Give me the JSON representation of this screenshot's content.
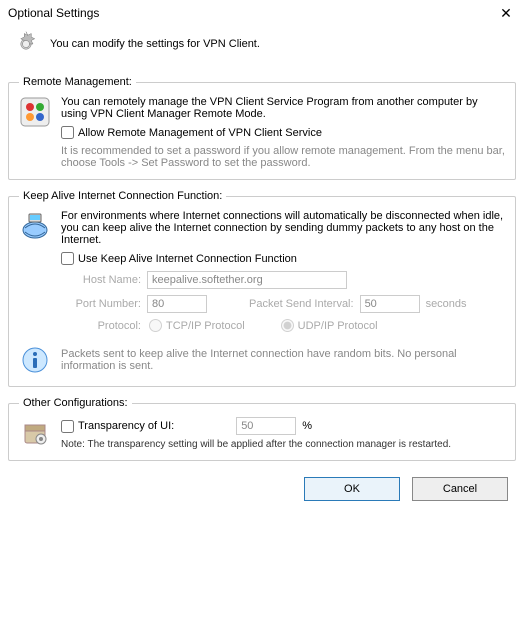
{
  "window": {
    "title": "Optional Settings"
  },
  "header": {
    "text": "You can modify the settings for VPN Client."
  },
  "remote": {
    "legend": "Remote Management:",
    "desc": "You can remotely manage the VPN Client Service Program from another computer by using VPN Client Manager Remote Mode.",
    "checkbox": "Allow Remote Management of VPN Client Service",
    "hint": "It is recommended to set a password if you allow remote management. From the menu bar, choose Tools -> Set Password to set the password."
  },
  "keepalive": {
    "legend": "Keep Alive Internet Connection Function:",
    "desc": "For environments where Internet connections will automatically be disconnected when idle, you can keep alive the Internet connection by sending dummy packets to any host on the Internet.",
    "checkbox": "Use Keep Alive Internet Connection Function",
    "host_label": "Host Name:",
    "host_value": "keepalive.softether.org",
    "port_label": "Port Number:",
    "port_value": "80",
    "interval_label": "Packet Send Interval:",
    "interval_value": "50",
    "interval_unit": "seconds",
    "protocol_label": "Protocol:",
    "tcp": "TCP/IP Protocol",
    "udp": "UDP/IP Protocol",
    "info": "Packets sent to keep alive the Internet connection have random bits. No personal information is sent."
  },
  "other": {
    "legend": "Other Configurations:",
    "transparency_label": "Transparency of UI:",
    "transparency_value": "50",
    "transparency_unit": "%",
    "note": "Note: The transparency setting will be applied after the connection manager is restarted."
  },
  "buttons": {
    "ok": "OK",
    "cancel": "Cancel"
  }
}
